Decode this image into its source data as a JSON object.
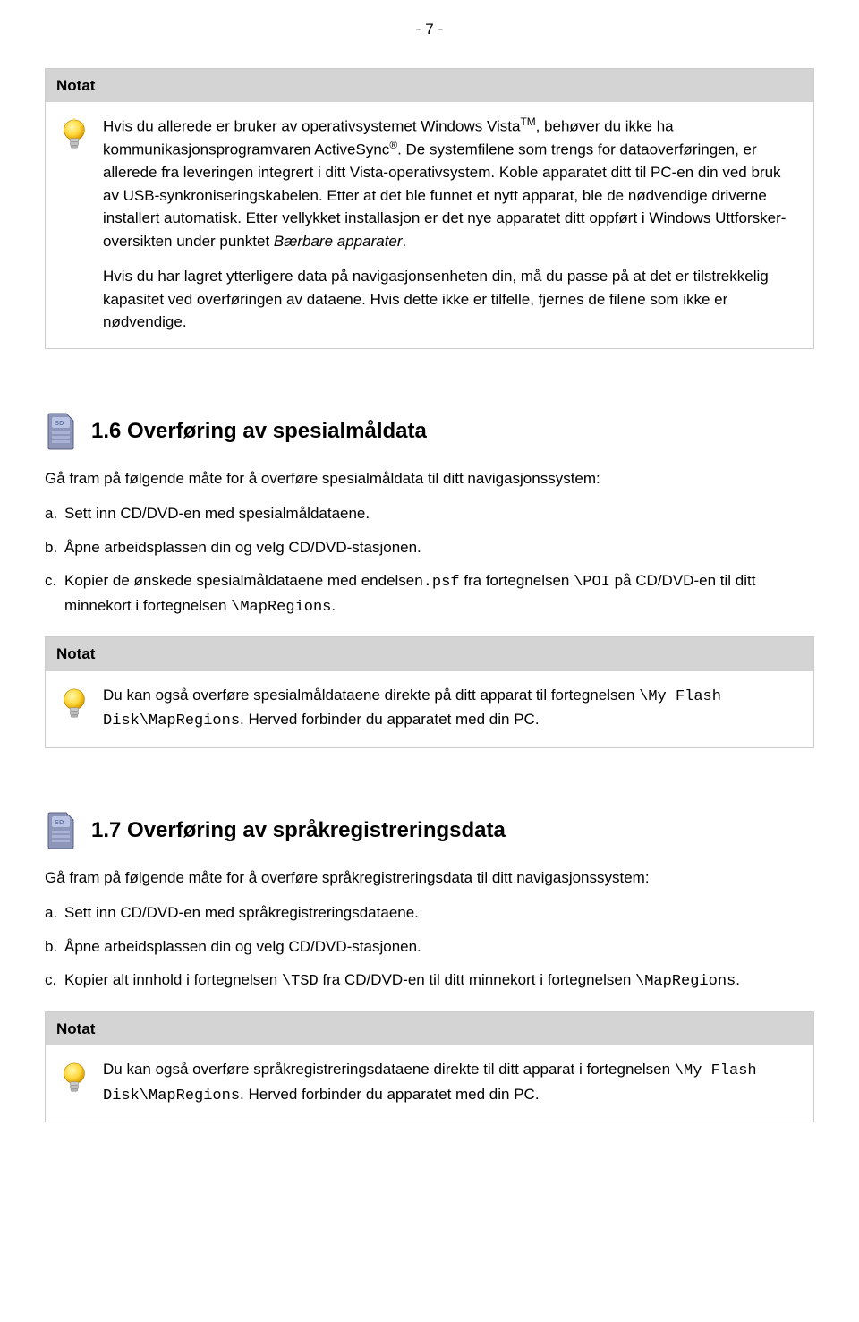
{
  "page_number": "- 7 -",
  "note1": {
    "header": "Notat",
    "p1a": "Hvis du allerede er bruker av operativsystemet Windows Vista",
    "p1b": ", behøver du ikke ha kommunikasjonsprogramvaren ActiveSync",
    "p1c": ". De systemfilene som trengs for dataoverføringen, er allerede fra leveringen integrert i ditt Vista-operativsystem. Koble apparatet ditt til PC-en din ved bruk av USB-synkroniseringskabelen. Etter at det ble funnet et nytt apparat, ble de nødvendige driverne installert automatisk. Etter vellykket installasjon er det nye apparatet ditt oppført i Windows Uttforsker-oversikten under punktet ",
    "p1d": "Bærbare apparater",
    "p1e": ".",
    "tm": "TM",
    "reg": "®",
    "p2": "Hvis du har lagret ytterligere data på navigasjonsenheten din, må du passe på at det er tilstrekkelig kapasitet ved overføringen av dataene. Hvis dette ikke er tilfelle, fjernes de filene som ikke er nødvendige."
  },
  "section16": {
    "heading": "1.6 Overføring av spesialmåldata",
    "intro": "Gå fram på følgende måte for å overføre spesialmåldata til ditt navigasjonssystem:",
    "steps": {
      "a": {
        "letter": "a.",
        "text": "Sett inn CD/DVD-en med spesialmåldataene."
      },
      "b": {
        "letter": "b.",
        "text": "Åpne arbeidsplassen din og velg CD/DVD-stasjonen."
      },
      "c": {
        "letter": "c.",
        "t1": "Kopier de ønskede spesialmåldataene med endelsen",
        "m1": ".psf",
        "t2": " fra fortegnelsen ",
        "m2": "\\POI",
        "t3": " på CD/DVD-en til ditt minnekort i fortegnelsen ",
        "m3": "\\MapRegions",
        "t4": "."
      }
    }
  },
  "note2": {
    "header": "Notat",
    "t1": "Du kan også overføre spesialmåldataene direkte på ditt apparat til fortegnelsen ",
    "m1": "\\My Flash Disk\\MapRegions",
    "t2": ". Herved forbinder du apparatet med din PC."
  },
  "section17": {
    "heading": "1.7 Overføring av språkregistreringsdata",
    "intro": "Gå fram på følgende måte for å overføre språkregistreringsdata til ditt navigasjonssystem:",
    "steps": {
      "a": {
        "letter": "a.",
        "text": "Sett inn CD/DVD-en med språkregistreringsdataene."
      },
      "b": {
        "letter": "b.",
        "text": "Åpne arbeidsplassen din og velg CD/DVD-stasjonen."
      },
      "c": {
        "letter": "c.",
        "t1": "Kopier alt innhold i fortegnelsen ",
        "m1": "\\TSD",
        "t2": " fra CD/DVD-en til ditt minnekort i fortegnelsen ",
        "m2": "\\MapRegions",
        "t3": "."
      }
    }
  },
  "note3": {
    "header": "Notat",
    "t1": "Du kan også overføre språkregistreringsdataene direkte til ditt apparat i fortegnelsen ",
    "m1": "\\My Flash Disk\\MapRegions",
    "t2": ". Herved forbinder du apparatet med din PC."
  }
}
